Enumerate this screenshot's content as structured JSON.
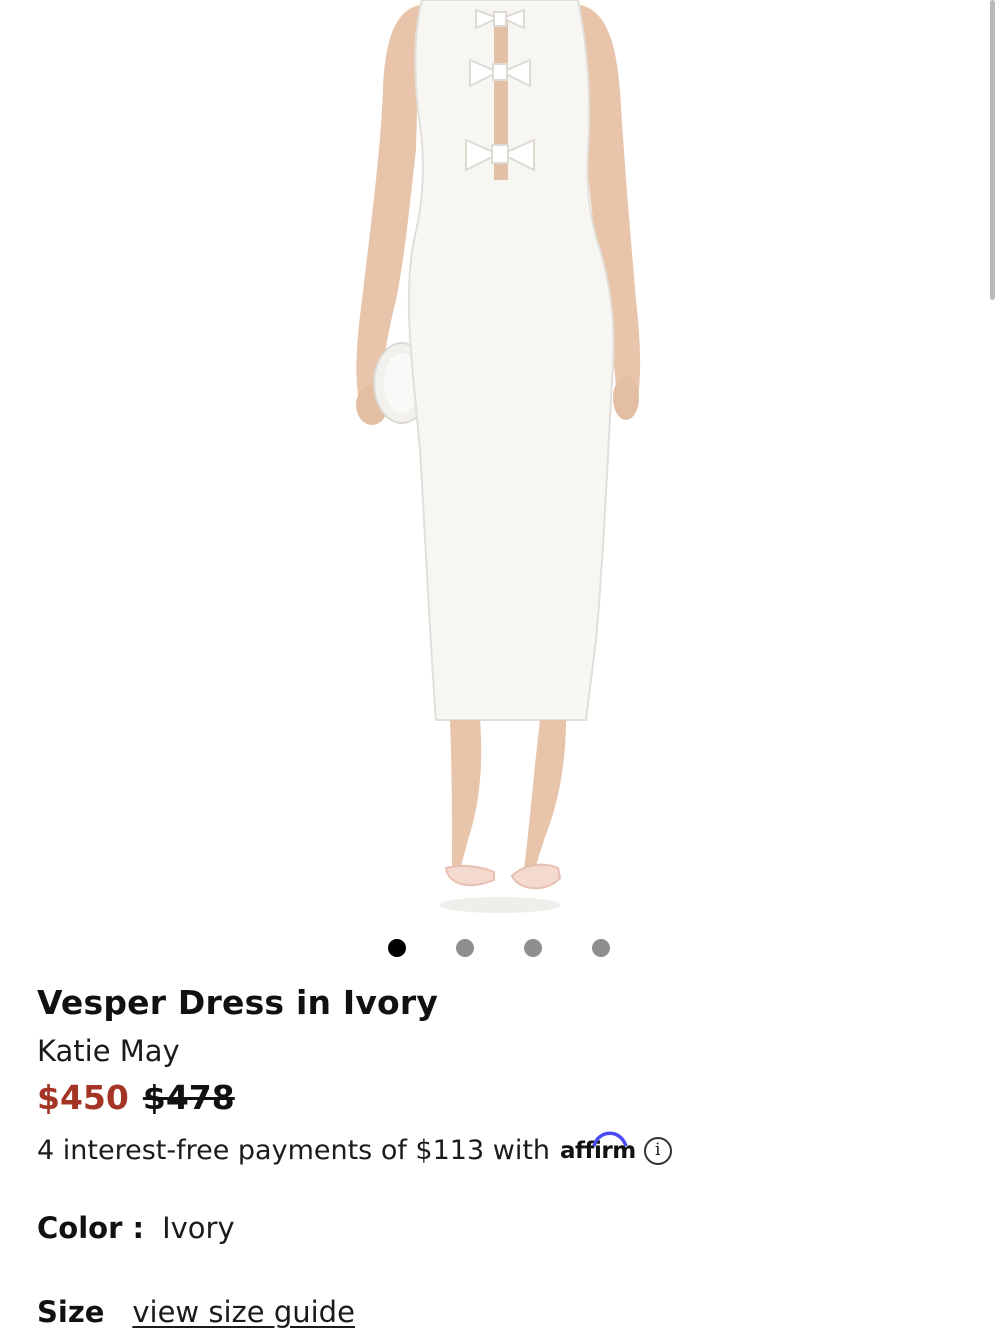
{
  "product": {
    "title": "Vesper Dress in Ivory",
    "brand": "Katie May",
    "sale_price": "$450",
    "original_price": "$478",
    "payment_text": "4 interest-free payments of $113 with",
    "payment_provider": "affirm",
    "info_glyph": "i"
  },
  "gallery": {
    "image_count": 4,
    "active_index": 0
  },
  "color": {
    "label": "Color :",
    "value": "Ivory"
  },
  "size": {
    "label": "Size",
    "guide_link": "view size guide"
  },
  "colors": {
    "sale": "#a43424",
    "text": "#111111",
    "dot_inactive": "#8f8f8f",
    "dot_active": "#000000",
    "affirm_arc": "#4a4af4"
  }
}
